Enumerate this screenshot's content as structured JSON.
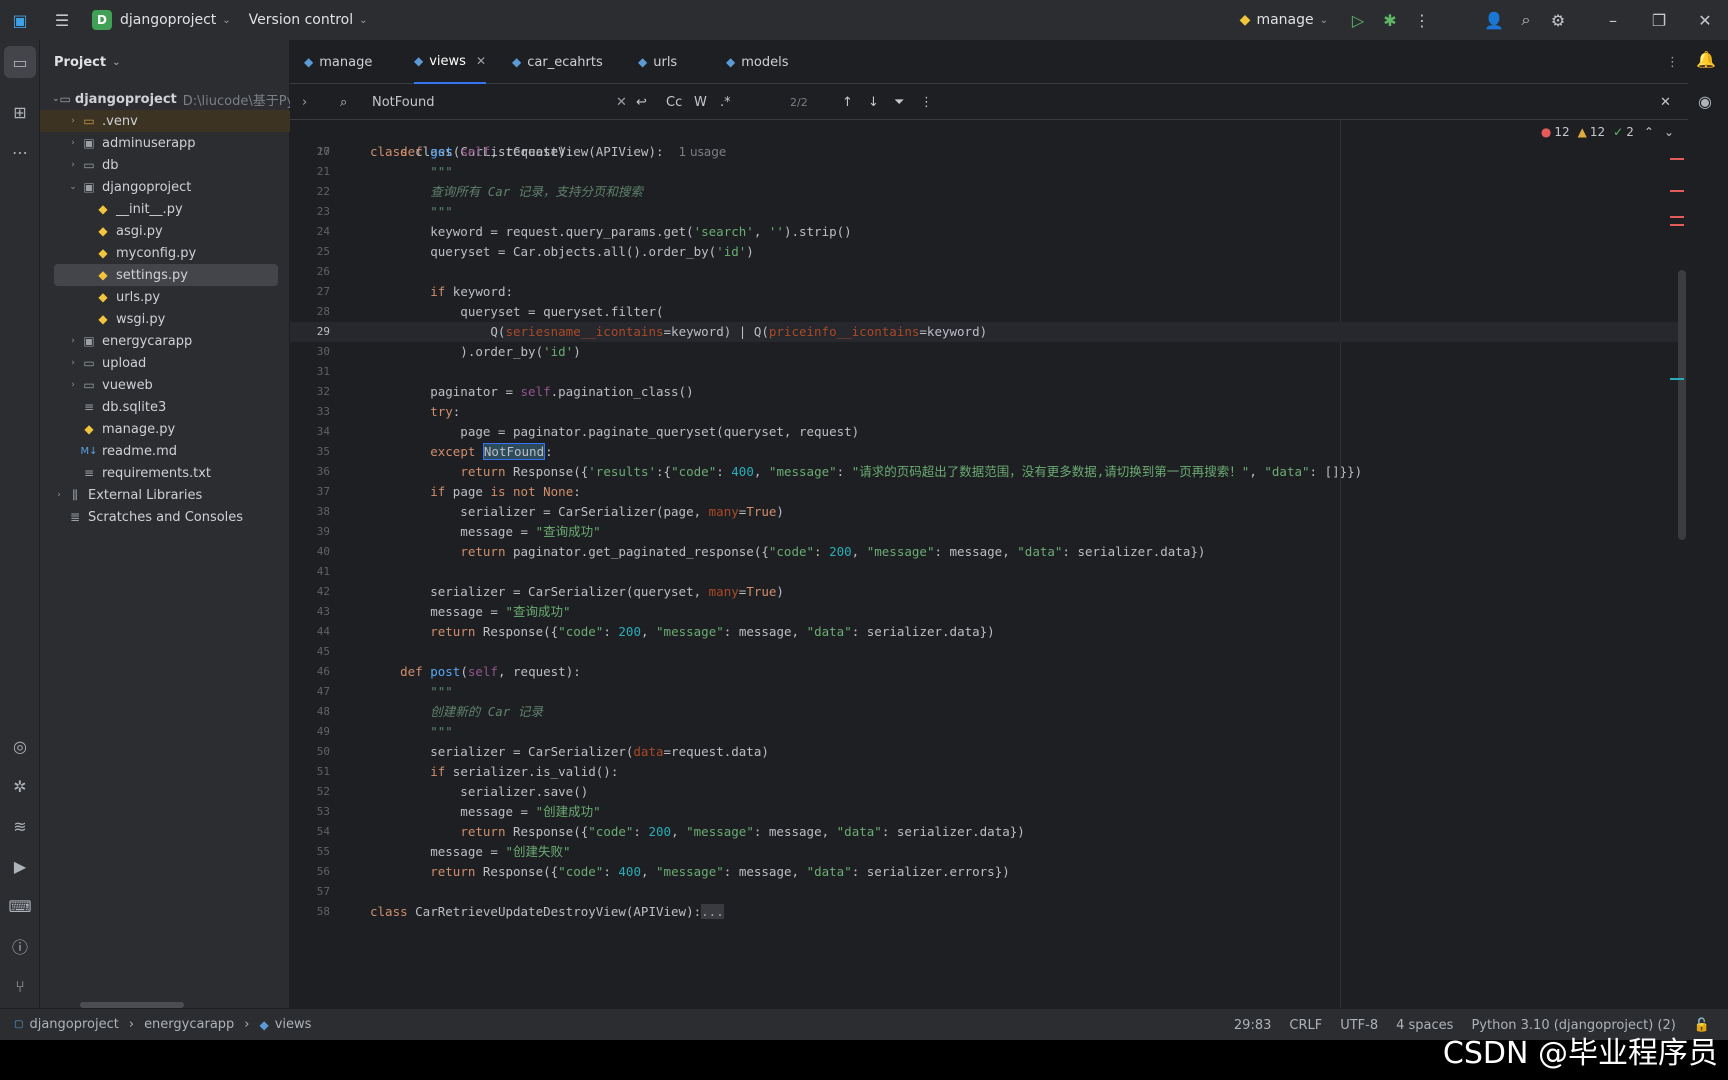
{
  "titlebar": {
    "project_initial": "D",
    "project_name": "djangoproject",
    "vcs": "Version control",
    "run_config": "manage"
  },
  "project_panel": {
    "title": "Project",
    "root": {
      "name": "djangoproject",
      "path": "D:\\liucode\\基于Py"
    },
    "items": [
      {
        "label": ".venv",
        "type": "folder"
      },
      {
        "label": "adminuserapp",
        "type": "folder"
      },
      {
        "label": "db",
        "type": "folder"
      },
      {
        "label": "djangoproject",
        "type": "folder"
      },
      {
        "label": "__init__.py",
        "type": "py"
      },
      {
        "label": "asgi.py",
        "type": "py"
      },
      {
        "label": "myconfig.py",
        "type": "py"
      },
      {
        "label": "settings.py",
        "type": "py"
      },
      {
        "label": "urls.py",
        "type": "py"
      },
      {
        "label": "wsgi.py",
        "type": "py"
      },
      {
        "label": "energycarapp",
        "type": "folder"
      },
      {
        "label": "upload",
        "type": "folder"
      },
      {
        "label": "vueweb",
        "type": "folder"
      },
      {
        "label": "db.sqlite3",
        "type": "file"
      },
      {
        "label": "manage.py",
        "type": "py"
      },
      {
        "label": "readme.md",
        "type": "md"
      },
      {
        "label": "requirements.txt",
        "type": "file"
      },
      {
        "label": "External Libraries",
        "type": "lib"
      },
      {
        "label": "Scratches and Consoles",
        "type": "scratch"
      }
    ]
  },
  "tabs": [
    "manage",
    "views",
    "car_ecahrts",
    "urls",
    "models"
  ],
  "find": {
    "query": "NotFound",
    "count": "2/2",
    "case": "Cc",
    "word": "W",
    "regex": ".*"
  },
  "inspections": {
    "errors": "12",
    "warnings": "12",
    "ok": "2"
  },
  "code": {
    "sticky_header": "class CarListCreateView(APIView):",
    "usage": "1 usage"
  },
  "status": {
    "breadcrumb": [
      "djangoproject",
      "energycarapp",
      "views"
    ],
    "position": "29:83",
    "line_sep": "CRLF",
    "encoding": "UTF-8",
    "indent": "4 spaces",
    "interpreter": "Python 3.10 (djangoproject) (2)"
  },
  "watermark": "CSDN @毕业程序员"
}
